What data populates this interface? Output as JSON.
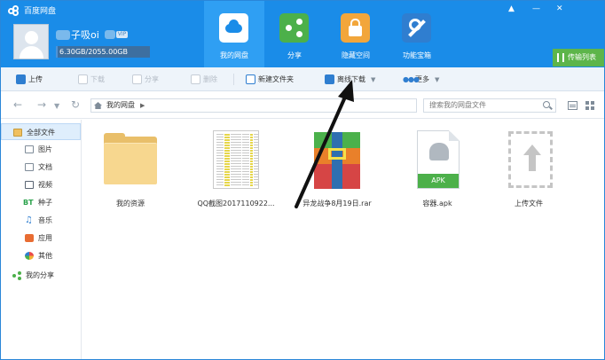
{
  "app": {
    "title": "百度网盘"
  },
  "user": {
    "name": "子吸oi",
    "vip_badge": "VIP",
    "quota_text": "6.30GB/2055.00GB",
    "quota_fraction": 0.003
  },
  "nav_tabs": [
    {
      "label": "我的网盘",
      "icon": "cloud-disk-icon",
      "active": true
    },
    {
      "label": "分享",
      "icon": "share-icon",
      "active": false
    },
    {
      "label": "隐藏空间",
      "icon": "lock-icon",
      "active": false
    },
    {
      "label": "功能宝箱",
      "icon": "tools-icon",
      "active": false
    }
  ],
  "window_controls": {
    "pin": "▲",
    "minimize": "—",
    "close": "✕"
  },
  "transfer_list": {
    "label": "传输列表"
  },
  "toolbar": {
    "upload": "上传",
    "download": "下载",
    "share": "分享",
    "delete": "删除",
    "new_folder": "新建文件夹",
    "offline_download": "离线下载",
    "more": "更多"
  },
  "address": {
    "path": "我的网盘",
    "search_placeholder": "搜索我的网盘文件"
  },
  "sidebar": {
    "all_files": "全部文件",
    "categories": [
      "图片",
      "文档",
      "视频",
      "种子",
      "音乐",
      "应用",
      "其他"
    ],
    "bt_label": "BT",
    "my_share": "我的分享"
  },
  "files": [
    {
      "name": "我的资源",
      "type": "folder"
    },
    {
      "name": "QQ截图2017110922...",
      "type": "image"
    },
    {
      "name": "异龙战争8月19日.rar",
      "type": "archive"
    },
    {
      "name": "容器.apk",
      "type": "apk",
      "badge": "APK"
    },
    {
      "name": "上传文件",
      "type": "upload"
    }
  ],
  "colors": {
    "header": "#1a8ce8",
    "active_tab": "#2f9ff3",
    "transfer_button": "#5db54a",
    "annotation_arrow": "#111111"
  }
}
